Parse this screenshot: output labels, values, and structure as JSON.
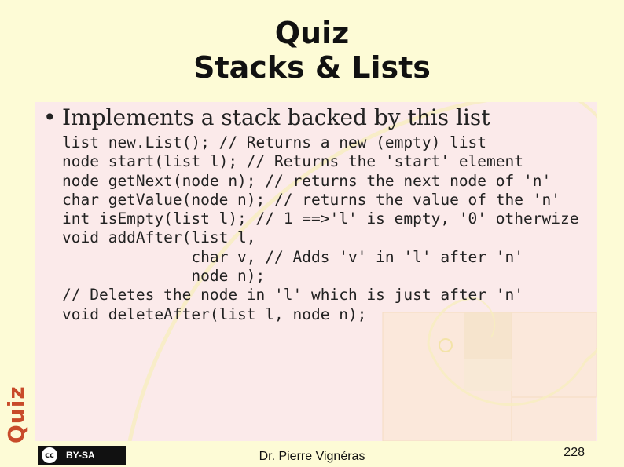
{
  "slide": {
    "title_line1": "Quiz",
    "title_line2": "Stacks & Lists",
    "bullet_marker": "•",
    "bullet_text": "Implements a stack backed by this list",
    "code_lines": [
      "list new.List(); // Returns a new (empty) list",
      "node start(list l); // Returns the 'start' element",
      "node getNext(node n); // returns the next node of 'n'",
      "char getValue(node n); // returns the value of the 'n'",
      "int isEmpty(list l); // 1 ==>'l' is empty, '0' otherwize",
      "void addAfter(list l,",
      "              char v, // Adds 'v' in 'l' after 'n'",
      "              node n);",
      "// Deletes the node in 'l' which is just after 'n'",
      "void deleteAfter(list l, node n);"
    ],
    "side_label": "Quiz"
  },
  "footer": {
    "license_icon": "cc",
    "license_text": "BY-SA",
    "author": "Dr. Pierre Vignéras",
    "page_number": "228"
  },
  "colors": {
    "background": "#fdfbd6",
    "panel": "#fbeaea",
    "side_label": "#c84b2a"
  }
}
